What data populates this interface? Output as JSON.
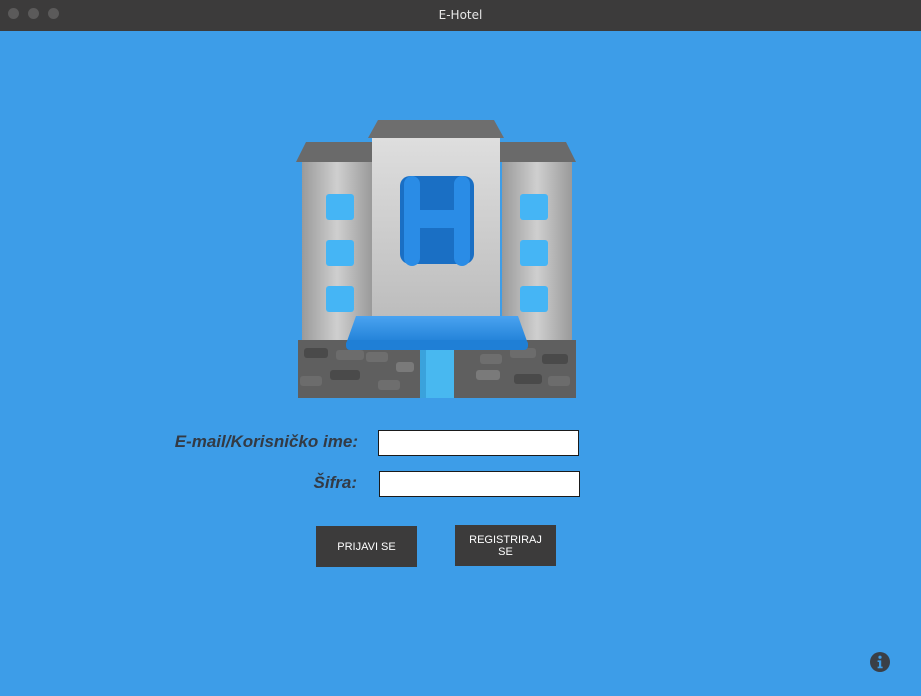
{
  "window": {
    "title": "E-Hotel"
  },
  "login_form": {
    "email_label": "E-mail/Korisničko ime:",
    "email_value": "",
    "password_label": "Šifra:",
    "password_value": "",
    "login_button": "PRIJAVI SE",
    "register_button": "REGISTRIRAJ SE"
  },
  "logo": {
    "letter": "H",
    "icon": "hotel-building-icon"
  },
  "icons": {
    "info": "info-icon"
  },
  "colors": {
    "background": "#3d9de8",
    "titlebar": "#3c3b3b",
    "button": "#3c3b3b",
    "label_text": "#333a44"
  }
}
